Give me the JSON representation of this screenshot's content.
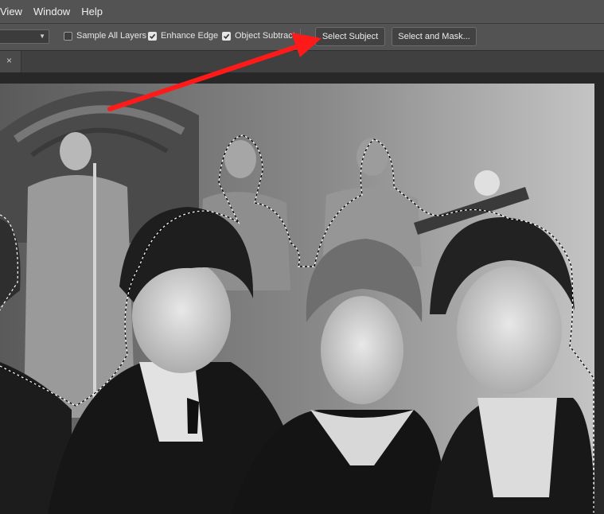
{
  "menu": [
    "View",
    "Window",
    "Help"
  ],
  "options": {
    "sample_all_layers": {
      "label": "Sample All Layers",
      "checked": false
    },
    "enhance_edge": {
      "label": "Enhance Edge",
      "checked": true
    },
    "object_subtract": {
      "label": "Object Subtract",
      "checked": true
    },
    "select_subject": "Select Subject",
    "select_and_mask": "Select and Mask..."
  },
  "tab": {
    "close_glyph": "×"
  },
  "colors": {
    "annotation_arrow": "#ff1a1a",
    "marching_ants": "#ffffff"
  }
}
